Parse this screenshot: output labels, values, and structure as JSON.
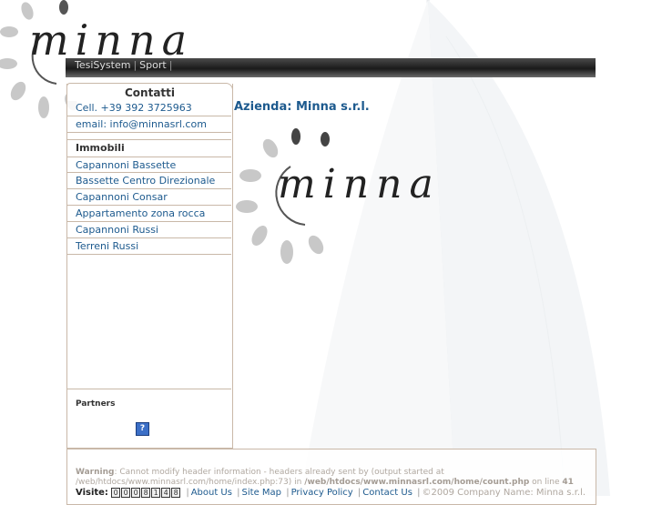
{
  "header": {
    "logo_text": "minna",
    "nav": [
      "TesiSystem",
      "Sport"
    ]
  },
  "sidebar": {
    "contacts_title": "Contatti",
    "contacts": [
      "Cell. +39 392 3725963",
      "email: info@minnasrl.com"
    ],
    "immobili_title": "Immobili",
    "immobili": [
      "Capannoni Bassette",
      "Bassette Centro Direzionale",
      "Capannoni Consar",
      "Appartamento zona rocca",
      "Capannoni Russi",
      "Terreni Russi"
    ],
    "partners_title": "Partners",
    "partner_icon": "?"
  },
  "main": {
    "title": "Azienda: Minna s.r.l.",
    "logo_text": "minna"
  },
  "footer": {
    "warning_label": "Warning",
    "warning_text_1": ": Cannot modify header information - headers already sent by (output started at",
    "warning_path_1": "/web/htdocs/www.minnasrl.com/home/index.php:73) in",
    "warning_path_2": "/web/htdocs/www.minnasrl.com/home/count.php",
    "warning_on_line": "on line",
    "warning_line": "41",
    "visits_label": "Visite:",
    "counter_digits": [
      "0",
      "0",
      "0",
      "8",
      "1",
      "4",
      "8"
    ],
    "links": [
      "About Us",
      "Site Map",
      "Privacy Policy",
      "Contact Us"
    ],
    "copyright": "©2009 Company Name: Minna s.r.l."
  },
  "colors": {
    "link": "#1d5a8e",
    "border": "#c9b8a8",
    "topbar": "#1a1a1a"
  }
}
